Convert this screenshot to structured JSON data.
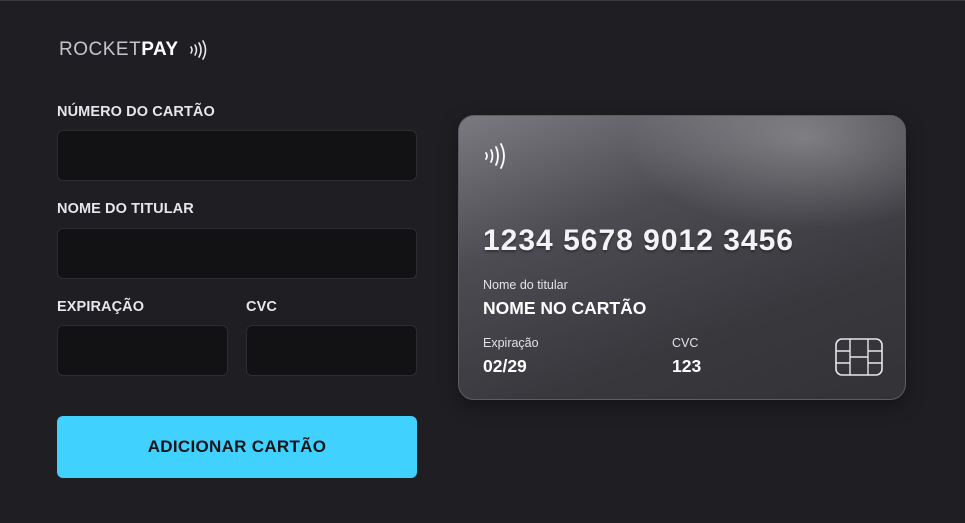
{
  "brand": {
    "light": "ROCKET",
    "bold": "PAY",
    "icon": "contactless-icon"
  },
  "form": {
    "card_number_label": "NÚMERO DO CARTÃO",
    "holder_label": "NOME DO TITULAR",
    "expiry_label": "EXPIRAÇÃO",
    "cvc_label": "CVC",
    "card_number_value": "",
    "holder_value": "",
    "expiry_value": "",
    "cvc_value": "",
    "submit_label": "ADICIONAR CARTÃO"
  },
  "card": {
    "number": "1234 5678 9012 3456",
    "holder_label": "Nome do titular",
    "holder_name": "NOME NO CARTÃO",
    "expiry_label": "Expiração",
    "expiry_value": "02/29",
    "cvc_label": "CVC",
    "cvc_value": "123",
    "chip_icon": "chip-icon",
    "contactless_icon": "contactless-icon"
  },
  "colors": {
    "background": "#1f1f23",
    "input_bg": "#121215",
    "accent": "#41d1ff",
    "card_gradient_start": "#7a7a80",
    "card_gradient_end": "#333337"
  }
}
